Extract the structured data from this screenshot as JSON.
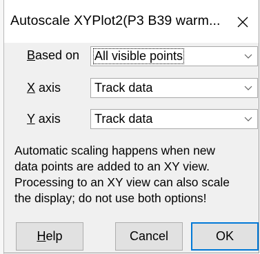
{
  "window": {
    "title": "Autoscale XYPlot2(P3 B39 warm..."
  },
  "fields": [
    {
      "label_mnemonic": "B",
      "label_rest": "ased on",
      "value": "All visible points"
    },
    {
      "label_mnemonic": "X",
      "label_rest": " axis",
      "value": "Track data"
    },
    {
      "label_mnemonic": "Y",
      "label_rest": " axis",
      "value": "Track data"
    }
  ],
  "description": {
    "lines": [
      "Automatic scaling happens when new",
      "data points are added to an XY view.",
      "Processing to an XY view can also scale",
      "the display; do not use both options!"
    ]
  },
  "buttons": {
    "help_mnemonic": "H",
    "help_rest": "elp",
    "cancel": "Cancel",
    "ok": "OK"
  },
  "icons": {
    "close": "close-icon",
    "dropdown": "chevron-down-icon"
  },
  "colors": {
    "dialog_bg": "#f0f0f0",
    "button_bg": "#e1e1e1",
    "default_button_border": "#0078d7"
  }
}
